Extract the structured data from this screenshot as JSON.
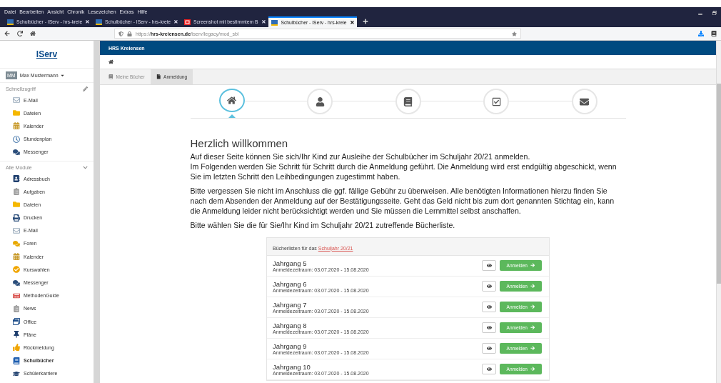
{
  "browser": {
    "menu": [
      "Datei",
      "Bearbeiten",
      "Ansicht",
      "Chronik",
      "Lesezeichen",
      "Extras",
      "Hilfe"
    ],
    "tabs": [
      {
        "title": "Schulbücher - IServ - hrs-kreie",
        "selected": false
      },
      {
        "title": "Schulbücher - IServ - hrs-kreie",
        "selected": false
      },
      {
        "title": "Screenshot mit bestimmtem B",
        "selected": false
      },
      {
        "title": "Schulbücher - IServ - hrs-kreie",
        "selected": true
      }
    ],
    "url": {
      "prefix": "https://",
      "domain": "hrs-kreiensen.de",
      "path": "/iserv/legacy/mod_sbl"
    }
  },
  "sidebar": {
    "logo": "IServ",
    "user": {
      "initials": "MM",
      "name": "Max Mustermann"
    },
    "sections": [
      {
        "title": "Schnellzugriff",
        "items": [
          {
            "label": "E-Mail",
            "selected": false
          },
          {
            "label": "Dateien",
            "selected": false
          },
          {
            "label": "Kalender",
            "selected": false
          },
          {
            "label": "Stundenplan",
            "selected": false
          },
          {
            "label": "Messenger",
            "selected": false
          }
        ]
      },
      {
        "title": "Alle Module",
        "items": [
          {
            "label": "Adressbuch",
            "selected": false
          },
          {
            "label": "Aufgaben",
            "selected": false
          },
          {
            "label": "Dateien",
            "selected": false
          },
          {
            "label": "Drucken",
            "selected": false
          },
          {
            "label": "E-Mail",
            "selected": false
          },
          {
            "label": "Foren",
            "selected": false
          },
          {
            "label": "Kalender",
            "selected": false
          },
          {
            "label": "Kurswahlen",
            "selected": false
          },
          {
            "label": "Messenger",
            "selected": false
          },
          {
            "label": "MethodenGuide",
            "selected": false
          },
          {
            "label": "News",
            "selected": false
          },
          {
            "label": "Office",
            "selected": false
          },
          {
            "label": "Pläne",
            "selected": false
          },
          {
            "label": "Rückmeldung",
            "selected": false
          },
          {
            "label": "Schulbücher",
            "selected": true
          },
          {
            "label": "Schülerkarriere",
            "selected": false
          }
        ]
      }
    ]
  },
  "header": {
    "title": "HRS Kreiensen"
  },
  "module_tabs": [
    {
      "label": "Meine Bücher",
      "selected": false
    },
    {
      "label": "Anmeldung",
      "selected": true
    }
  ],
  "steps": [
    {
      "selected": true
    },
    {
      "selected": false
    },
    {
      "selected": false
    },
    {
      "selected": false
    },
    {
      "selected": false
    }
  ],
  "content": {
    "heading": "Herzlich willkommen",
    "paragraphs": [
      "Auf dieser Seite können Sie sich/Ihr Kind zur Ausleihe der Schulbücher im Schuljahr 20/21 anmelden.\nIm Folgenden werden Sie Schritt für Schritt durch die Anmeldung geführt. Die Anmeldung wird erst endgültig abgeschickt, wenn Sie im letzten Schritt den Leihbedingungen zugestimmt haben.",
      "Bitte vergessen Sie nicht im Anschluss die ggf. fällige Gebühr zu überweisen. Alle benötigten Informationen hierzu finden Sie nach dem Absenden der Anmeldung auf der Bestätigungsseite. Geht das Geld nicht bis zum dort genannten Stichtag ein, kann die Anmeldung leider nicht berücksichtigt werden und Sie müssen die Lernmittel selbst anschaffen.",
      "Bitte wählen Sie die für Sie/Ihr Kind im Schuljahr 20/21 zutreffende Bücherliste."
    ]
  },
  "booklists": {
    "title": "Bücherlisten für das",
    "link": "Schuljahr 20/21",
    "rows": [
      {
        "name": "Jahrgang 5",
        "period": "Anmeldezeitraum: 03.07.2020 - 15.08.2020",
        "button": "Anmelden"
      },
      {
        "name": "Jahrgang 6",
        "period": "Anmeldezeitraum: 03.07.2020 - 15.08.2020",
        "button": "Anmelden"
      },
      {
        "name": "Jahrgang 7",
        "period": "Anmeldezeitraum: 03.07.2020 - 15.08.2020",
        "button": "Anmelden"
      },
      {
        "name": "Jahrgang 8",
        "period": "Anmeldezeitraum: 03.07.2020 - 15.08.2020",
        "button": "Anmelden"
      },
      {
        "name": "Jahrgang 9",
        "period": "Anmeldezeitraum: 03.07.2020 - 15.08.2020",
        "button": "Anmelden"
      },
      {
        "name": "Jahrgang 10",
        "period": "Anmeldezeitraum: 03.07.2020 - 15.08.2020",
        "button": "Anmelden"
      }
    ]
  }
}
